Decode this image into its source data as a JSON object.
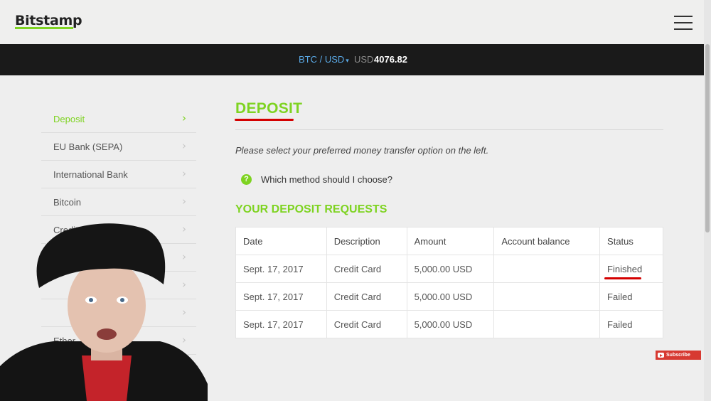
{
  "header": {
    "logo": "Bitstamp",
    "menu_icon": "hamburger-menu-icon"
  },
  "ticker": {
    "pair": "BTC / USD",
    "currency": "USD",
    "price": "4076.82"
  },
  "sidebar": {
    "items": [
      {
        "label": "Deposit",
        "active": true
      },
      {
        "label": "EU Bank (SEPA)"
      },
      {
        "label": "International Bank"
      },
      {
        "label": "Bitcoin"
      },
      {
        "label": "Credit C"
      },
      {
        "label": ""
      },
      {
        "label": ""
      },
      {
        "label": ""
      },
      {
        "label": "Ether"
      },
      {
        "label": ""
      }
    ]
  },
  "main": {
    "title": "DEPOSIT",
    "instructions": "Please select your preferred money transfer option on the left.",
    "help_icon_glyph": "?",
    "help_link": "Which method should I choose?",
    "requests_title": "YOUR DEPOSIT REQUESTS",
    "table": {
      "headers": [
        "Date",
        "Description",
        "Amount",
        "Account balance",
        "Status"
      ],
      "rows": [
        [
          "Sept. 17, 2017",
          "Credit Card",
          "5,000.00 USD",
          "",
          "Finished"
        ],
        [
          "Sept. 17, 2017",
          "Credit Card",
          "5,000.00 USD",
          "",
          "Failed"
        ],
        [
          "Sept. 17, 2017",
          "Credit Card",
          "5,000.00 USD",
          "",
          "Failed"
        ]
      ]
    }
  },
  "overlay": {
    "subscribe_label": "Subscribe"
  },
  "colors": {
    "accent": "#7ed321",
    "ticker_bg": "#1a1a1a",
    "annotation_red": "#d40000"
  }
}
